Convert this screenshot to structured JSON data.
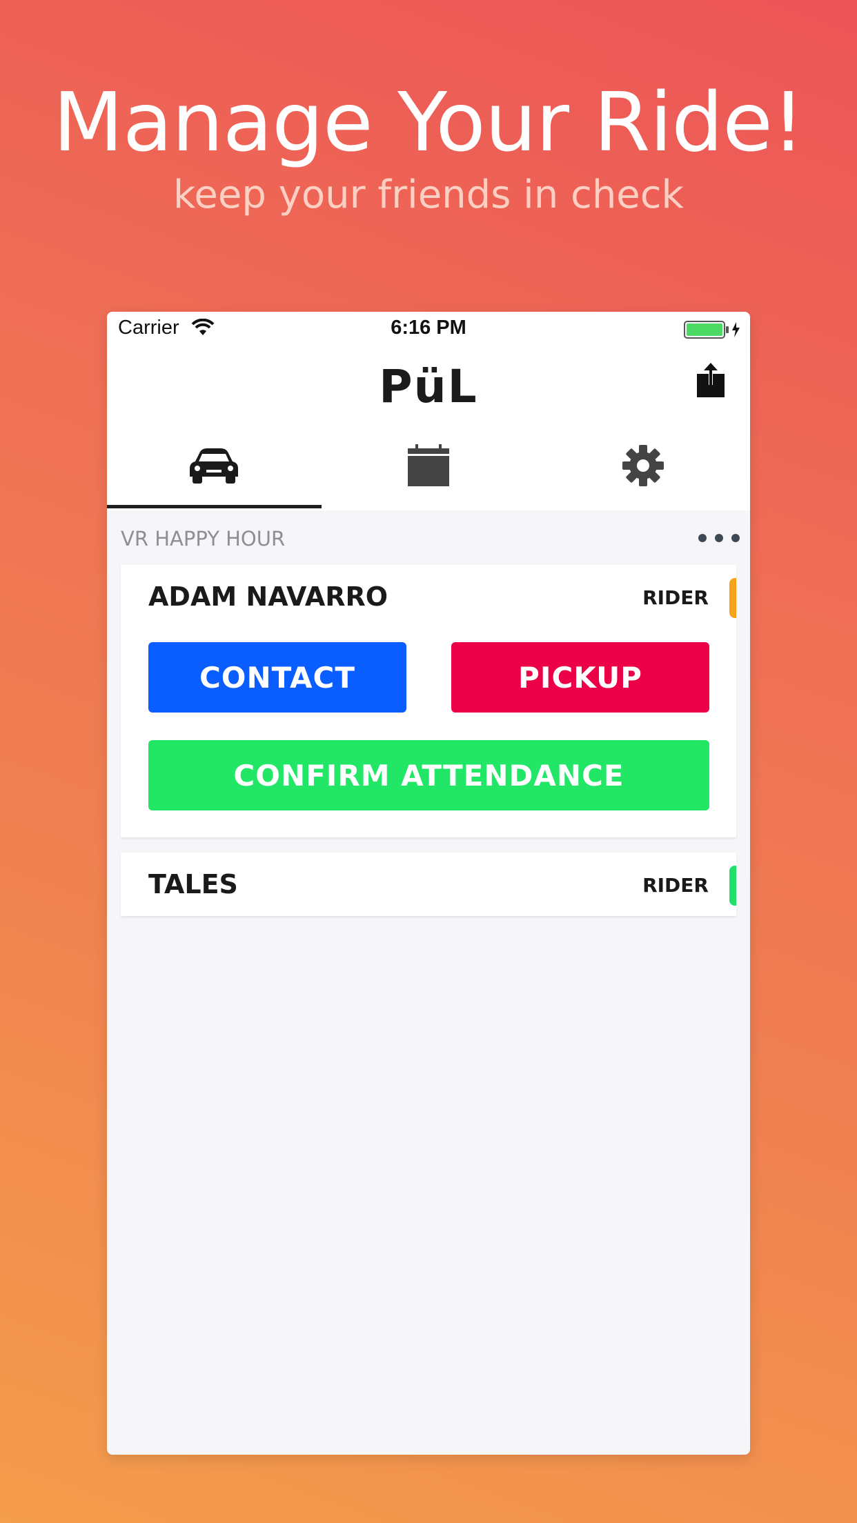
{
  "marketing": {
    "headline": "Manage Your Ride!",
    "subheadline": "keep your friends in check"
  },
  "status_bar": {
    "carrier": "Carrier",
    "time": "6:16 PM",
    "icons": [
      "wifi-icon",
      "battery-charging-icon"
    ],
    "battery_color": "#4cd964"
  },
  "nav": {
    "logo": "PüL",
    "share_icon": "share-icon"
  },
  "tabs": [
    {
      "icon": "car-icon",
      "active": true
    },
    {
      "icon": "calendar-icon",
      "active": false
    },
    {
      "icon": "gear-icon",
      "active": false
    }
  ],
  "section": {
    "title": "VR HAPPY HOUR",
    "more_icon": "more-dots-icon"
  },
  "cards": [
    {
      "name": "ADAM NAVARRO",
      "role": "RIDER",
      "status_color": "#f7a21b",
      "buttons": {
        "contact": "CONTACT",
        "pickup": "PICKUP",
        "confirm": "CONFIRM ATTENDANCE"
      }
    },
    {
      "name": "TALES",
      "role": "RIDER",
      "status_color": "#21e06a"
    }
  ],
  "colors": {
    "contact": "#0a5dff",
    "pickup": "#ec0047",
    "confirm": "#21e666"
  }
}
